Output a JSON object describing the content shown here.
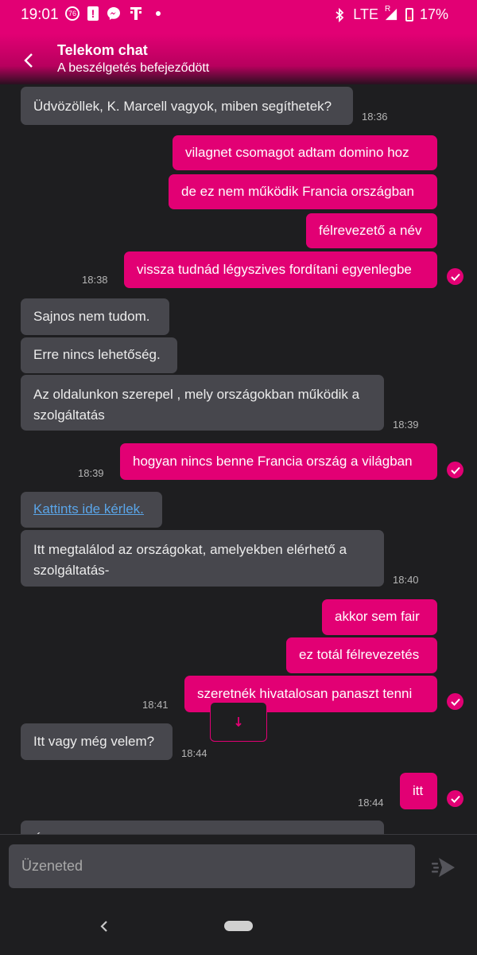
{
  "status_bar": {
    "time": "19:01",
    "badge_number": "76",
    "network": "LTE",
    "roaming": "R",
    "battery": "17%"
  },
  "header": {
    "title": "Telekom chat",
    "subtitle": "A beszélgetés befejeződött"
  },
  "messages": [
    {
      "side": "in",
      "text": "Üdvözöllek, K. Marcell vagyok, miben segíthetek?"
    },
    {
      "side": "out",
      "text": "vilagnet csomagot adtam domino hoz"
    },
    {
      "side": "out",
      "text": "de ez nem működik Francia országban"
    },
    {
      "side": "out",
      "text": "félrevezető a név"
    },
    {
      "side": "out",
      "text": "vissza tudnád légyszives fordítani egyenlegbe"
    },
    {
      "side": "in",
      "text": "Sajnos nem tudom."
    },
    {
      "side": "in",
      "text": "Erre nincs lehetőség."
    },
    {
      "side": "in",
      "text": "Az oldalunkon szerepel , mely országokban működik a szolgáltatás"
    },
    {
      "side": "out",
      "text": "hogyan nincs benne Francia ország a világban"
    },
    {
      "side": "in",
      "text": "Kattints ide kérlek."
    },
    {
      "side": "in",
      "text": "Itt megtalálod az országokat, amelyekben elérhető a szolgáltatás-"
    },
    {
      "side": "out",
      "text": "akkor sem fair"
    },
    {
      "side": "out",
      "text": "ez totál félrevezetés"
    },
    {
      "side": "out",
      "text": "szeretnék hivatalosan panaszt tenni"
    },
    {
      "side": "in",
      "text": "Itt vagy még velem?"
    },
    {
      "side": "out",
      "text": "itt"
    },
    {
      "side": "in",
      "text": "Ú..."
    }
  ],
  "timestamps": [
    "18:36",
    "18:38",
    "18:39",
    "18:39",
    "18:40",
    "18:41",
    "18:44",
    "18:44"
  ],
  "input": {
    "placeholder": "Üzeneted"
  },
  "colors": {
    "accent": "#e20074",
    "incoming_bubble": "#47474d",
    "background": "#1e1e20",
    "link": "#5aa5e8"
  }
}
